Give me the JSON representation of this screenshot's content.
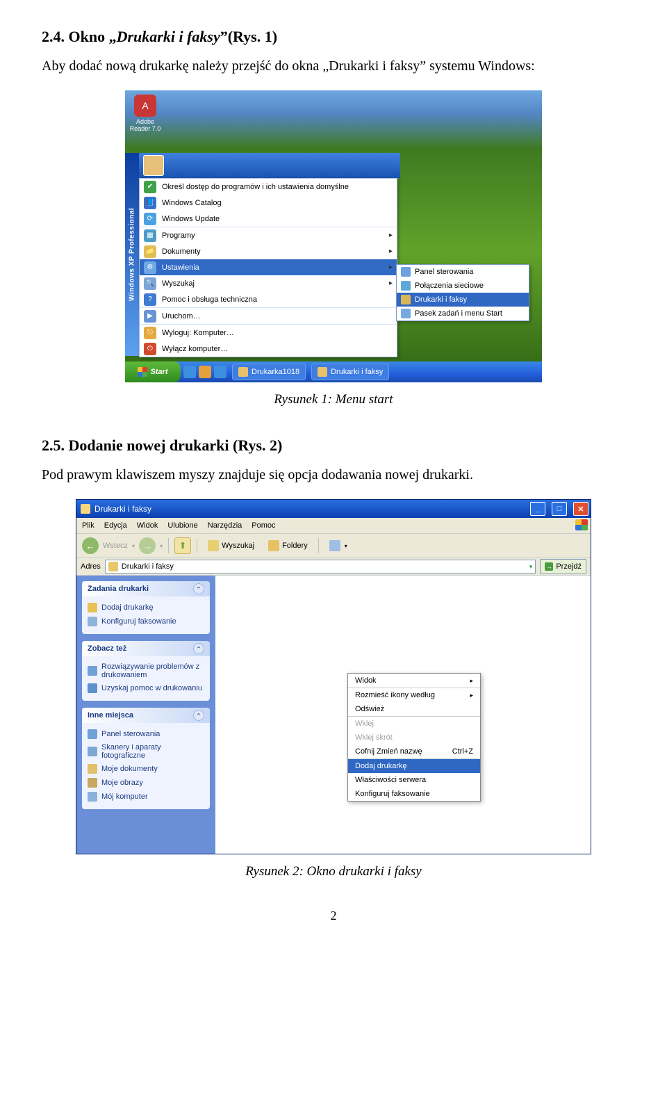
{
  "sec1": {
    "number": "2.4.",
    "title_prefix": "Okno „",
    "title_italic": "Drukarki i faksy",
    "title_suffix": "”(Rys. 1)",
    "para": "Aby dodać nową drukarkę należy przejść do okna „Drukarki i faksy” systemu Windows:"
  },
  "fig1": {
    "desktop_icon_label": "Adobe Reader 7.0",
    "band_text": "Windows XP Professional",
    "menu": {
      "items": [
        {
          "label": "Określ dostęp do programów i ich ustawienia domyślne",
          "color": "#3fa24b",
          "glyph": "✔"
        },
        {
          "label": "Windows Catalog",
          "color": "#3a6fd0",
          "glyph": "📘"
        },
        {
          "label": "Windows Update",
          "color": "#4aa3e0",
          "glyph": "⟳"
        },
        {
          "label": "Programy",
          "color": "#4c9cc8",
          "glyph": "▦",
          "arrow": true,
          "sep": true
        },
        {
          "label": "Dokumenty",
          "color": "#e0be56",
          "glyph": "📁",
          "arrow": true
        },
        {
          "label": "Ustawienia",
          "color": "#6fa7e5",
          "glyph": "⚙",
          "arrow": true,
          "hl": true
        },
        {
          "label": "Wyszukaj",
          "color": "#7da4d8",
          "glyph": "🔍",
          "arrow": true
        },
        {
          "label": "Pomoc i obsługa techniczna",
          "color": "#3f7bd0",
          "glyph": "?"
        },
        {
          "label": "Uruchom…",
          "color": "#6a93d6",
          "glyph": "▶",
          "sep": true
        },
        {
          "label": "Wyloguj: Komputer…",
          "color": "#e6a840",
          "glyph": "⎋",
          "sep": true
        },
        {
          "label": "Wyłącz komputer…",
          "color": "#d24a2e",
          "glyph": "⏻"
        }
      ]
    },
    "submenu": {
      "items": [
        {
          "label": "Panel sterowania",
          "color": "#6fa0df"
        },
        {
          "label": "Połączenia sieciowe",
          "color": "#5fa7d8"
        },
        {
          "label": "Drukarki i faksy",
          "color": "#d9b653",
          "hl": true
        },
        {
          "label": "Pasek zadań i menu Start",
          "color": "#76a9e0"
        }
      ]
    },
    "taskbar": {
      "start": "Start",
      "items": [
        {
          "label": "Drukarka1018",
          "color": "#e7c26b"
        },
        {
          "label": "Drukarki i faksy",
          "color": "#e7c26b"
        }
      ]
    },
    "caption": "Rysunek 1: Menu start"
  },
  "sec2": {
    "number": "2.5.",
    "title": "Dodanie nowej drukarki (Rys. 2)",
    "para": "Pod prawym klawiszem myszy znajduje się opcja dodawania nowej drukarki."
  },
  "fig2": {
    "title": "Drukarki i faksy",
    "menus": [
      "Plik",
      "Edycja",
      "Widok",
      "Ulubione",
      "Narzędzia",
      "Pomoc"
    ],
    "toolbar": {
      "back": "Wstecz",
      "search": "Wyszukaj",
      "folders": "Foldery"
    },
    "address": {
      "label": "Adres",
      "field": "Drukarki i faksy",
      "go": "Przejdź"
    },
    "panels": {
      "p1": {
        "head": "Zadania drukarki",
        "items": [
          {
            "label": "Dodaj drukarkę",
            "color": "#e6c257"
          },
          {
            "label": "Konfiguruj faksowanie",
            "color": "#8fb4da"
          }
        ]
      },
      "p2": {
        "head": "Zobacz też",
        "items": [
          {
            "label": "Rozwiązywanie problemów z drukowaniem",
            "color": "#6fa0d6"
          },
          {
            "label": "Uzyskaj pomoc w drukowaniu",
            "color": "#5e92ce"
          }
        ]
      },
      "p3": {
        "head": "Inne miejsca",
        "items": [
          {
            "label": "Panel sterowania",
            "color": "#6fa0d6"
          },
          {
            "label": "Skanery i aparaty fotograficzne",
            "color": "#7fa8d2"
          },
          {
            "label": "Moje dokumenty",
            "color": "#e0c06a"
          },
          {
            "label": "Moje obrazy",
            "color": "#c8a860"
          },
          {
            "label": "Mój komputer",
            "color": "#8ab1db"
          }
        ]
      }
    },
    "context": {
      "items": [
        {
          "label": "Widok",
          "arrow": true
        },
        {
          "label": "Rozmieść ikony według",
          "arrow": true,
          "sep": true
        },
        {
          "label": "Odśwież"
        },
        {
          "label": "Wklej",
          "disabled": true,
          "sep": true
        },
        {
          "label": "Wklej skrót",
          "disabled": true
        },
        {
          "label": "Cofnij Zmień nazwę",
          "shortcut": "Ctrl+Z"
        },
        {
          "label": "Dodaj drukarkę",
          "hl": true,
          "sep": true
        },
        {
          "label": "Właściwości serwera"
        },
        {
          "label": "Konfiguruj faksowanie"
        }
      ]
    },
    "caption": "Rysunek 2: Okno drukarki i faksy"
  },
  "page_num": "2"
}
